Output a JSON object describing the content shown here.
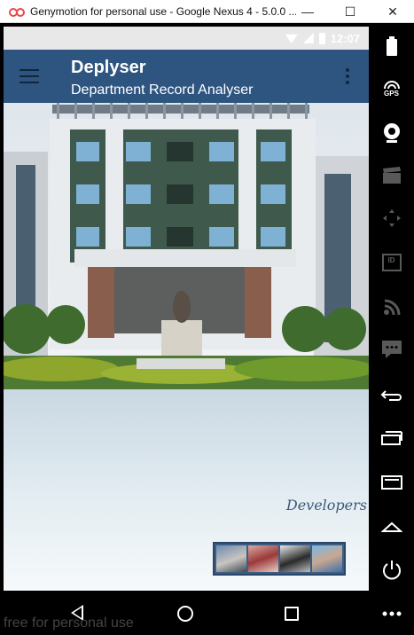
{
  "window": {
    "title": "Genymotion for personal use - Google Nexus 4 - 5.0.0 ...",
    "minimize": "—",
    "maximize": "☐",
    "close": "✕"
  },
  "status_bar": {
    "time": "12:07"
  },
  "app_bar": {
    "title": "Deplyser",
    "subtitle": "Department Record Analyser"
  },
  "content": {
    "developers_label": "Developers",
    "developer_photo_count": 4
  },
  "toolbar": {
    "gps_label": "GPS",
    "id_label": "ID"
  },
  "watermark": "free for personal use",
  "colors": {
    "app_bar": "#2e5580",
    "building_accent": "#3f5a4d"
  }
}
